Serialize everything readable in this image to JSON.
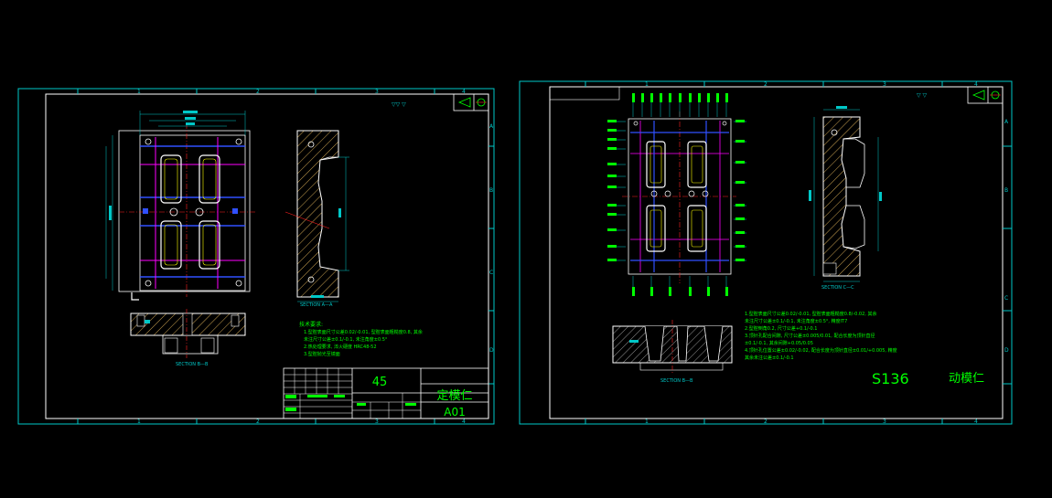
{
  "sheet_left": {
    "grid_cols": [
      "1",
      "2",
      "3",
      "4"
    ],
    "grid_rows": [
      "A",
      "B",
      "C",
      "D"
    ],
    "surface_mark": "▽▽ ▽",
    "title_block": {
      "material": "45",
      "part_name": "定模仁",
      "drawing_no": "A01"
    },
    "section_aa": "SECTION A—A",
    "section_bb": "SECTION B—B",
    "note_title": "技术要求:",
    "notes": [
      "1.型腔表面尺寸公差0.02/-0.01, 型腔表面粗糙度0.8, 其余",
      "  未注尺寸公差±0.1/-0.1, 未注角度±0.5°",
      "2.热处理要求, 淬火硬度 HRC48-52",
      "3.型腔抛光至镜面"
    ]
  },
  "sheet_right": {
    "grid_cols": [
      "1",
      "2",
      "3",
      "4"
    ],
    "grid_rows": [
      "A",
      "B",
      "C",
      "D"
    ],
    "surface_mark": "▽ ▽",
    "section_cc": "SECTION C—C",
    "section_bb": "SECTION B—B",
    "material": "S136",
    "part_name": "动模仁",
    "notes": [
      "1.型腔表面尺寸公差0.02/-0.01, 型腔表面粗糙度0.8/-0.02, 其余",
      "  未注尺寸公差±0.1/-0.1, 未注角度±0.5°, 精度IT7",
      "2.型腔倒角0.2, 尺寸公差+0.1/-0.1",
      "3.顶针孔配合间隙, 尺寸公差±0.005/0.01, 配合长度为顶针直径",
      "  ±0.1/-0.1, 其余间隙+0.05/0.05",
      "4.顶针孔位置公差±0.02/-0.02, 配合长度为顶针直径±0.01/+0.005, 精度",
      "  其余未注公差±0.1/-0.1"
    ]
  },
  "colors": {
    "frame": "#00c8c8",
    "white": "#ffffff",
    "green": "#00ff00",
    "yellow": "#ffff00",
    "red": "#ff2020",
    "blue": "#3050ff",
    "magenta": "#ff00ff",
    "hatch": "#ffcc66"
  }
}
